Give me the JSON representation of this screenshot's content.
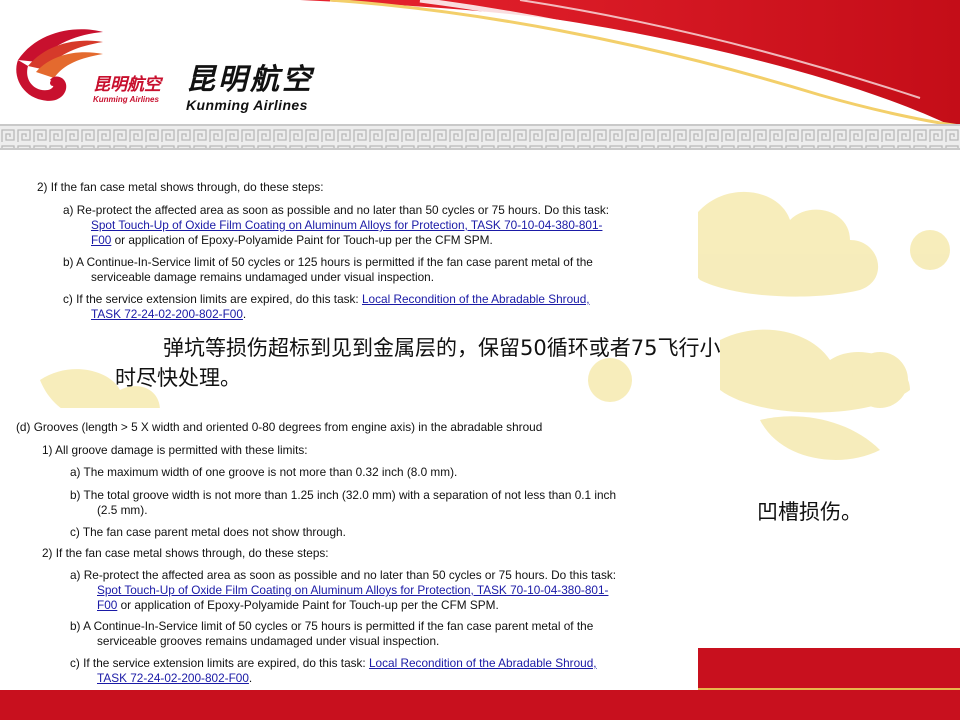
{
  "branding": {
    "small_cn": "昆明航空",
    "small_en": "Kunming Airlines",
    "large_cn": "昆明航空",
    "large_en": "Kunming Airlines"
  },
  "colors": {
    "brand_red": "#c8102e",
    "link_blue": "#1a1aa6",
    "watermark_yellow": "#f6ebb4"
  },
  "doc_top": {
    "item_2": "2)  If the fan case metal shows through, do these steps:",
    "item_a_l1": "a)  Re-protect the affected area as soon as possible and no later than 50 cycles or 75 hours. Do this task:",
    "item_a_link_l1": "Spot Touch-Up of Oxide Film Coating on Aluminum Alloys for Protection, TASK 70-10-04-380-801-",
    "item_a_link_l2": "F00",
    "item_a_tail": " or application of Epoxy-Polyamide Paint for Touch-up per the CFM SPM.",
    "item_b_l1": "b)  A Continue-In-Service limit of 50 cycles or 125 hours is permitted if the fan case parent metal of the",
    "item_b_l2": "serviceable damage remains undamaged under visual inspection.",
    "item_c_l1": "c)  If the service extension limits are expired, do this task: ",
    "item_c_link_l1": "Local Recondition of the Abradable Shroud,",
    "item_c_link_l2": "TASK 72-24-02-200-802-F00",
    "item_c_end": "."
  },
  "note_1": {
    "line1": "弹坑等损伤超标到见到金属层的，保留50循环或者75飞行小",
    "line2": "时尽快处理。"
  },
  "doc_bottom": {
    "heading": "(d)  Grooves (length > 5 X width and oriented 0-80 degrees from engine axis) in the abradable shroud",
    "item_1": "1)  All groove damage is permitted with these limits:",
    "item_1a": "a)  The maximum width of one groove is not more than 0.32 inch (8.0 mm).",
    "item_1b_l1": "b)  The total groove width is not more than 1.25 inch (32.0 mm) with a separation of not less than 0.1 inch",
    "item_1b_l2": "(2.5 mm).",
    "item_1c": "c)  The fan case parent metal does not show through.",
    "item_2": "2)  If the fan case metal shows through, do these steps:",
    "item_2a_l1": "a)  Re-protect the affected area as soon as possible and no later than 50 cycles or 75 hours. Do this task:",
    "item_2a_link_l1": "Spot Touch-Up of Oxide Film Coating on Aluminum Alloys for Protection, TASK 70-10-04-380-801-",
    "item_2a_link_l2": "F00",
    "item_2a_tail": " or application of Epoxy-Polyamide Paint for Touch-up per the CFM SPM.",
    "item_2b_l1": "b)  A Continue-In-Service limit of 50 cycles or 75 hours is permitted if the fan case parent metal of the",
    "item_2b_l2": "serviceable grooves remains undamaged under visual inspection.",
    "item_2c_l1": "c)  If the service extension limits are expired, do this task: ",
    "item_2c_link_l1": "Local Recondition of the Abradable Shroud,",
    "item_2c_link_l2": "TASK 72-24-02-200-802-F00",
    "item_2c_end": "."
  },
  "note_2": {
    "text": "凹槽损伤。"
  }
}
